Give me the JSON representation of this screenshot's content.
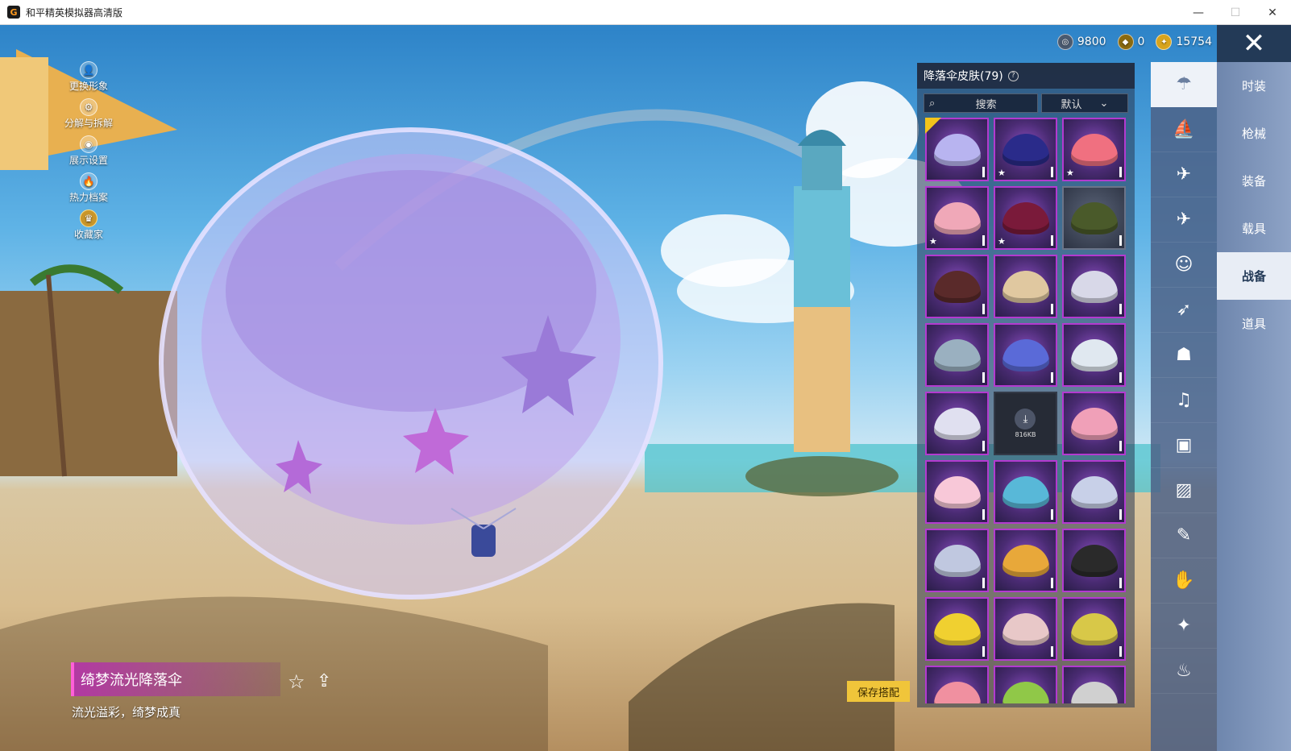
{
  "window": {
    "title": "和平精英模拟器高清版",
    "app_icon": "G",
    "minimize": "—",
    "maximize": "☐",
    "close": "✕"
  },
  "left_menu": [
    {
      "label": "更换形象",
      "icon": "user-icon",
      "glyph": "👤"
    },
    {
      "label": "分解与拆解",
      "icon": "gear-icon",
      "glyph": "⚙"
    },
    {
      "label": "展示设置",
      "icon": "eye-icon",
      "glyph": "◉"
    },
    {
      "label": "热力档案",
      "icon": "flame-icon",
      "glyph": "🔥"
    },
    {
      "label": "收藏家",
      "icon": "collector-icon",
      "glyph": "♛"
    }
  ],
  "currency": [
    {
      "value": "9800",
      "icon": "silver-coin-icon",
      "color": "#4a5a70"
    },
    {
      "value": "0",
      "icon": "gold-badge-icon",
      "color": "#8a6a10"
    },
    {
      "value": "15754",
      "icon": "coupon-icon",
      "color": "#d8a41c"
    }
  ],
  "close_glyph": "✕",
  "categories": [
    {
      "label": "时装",
      "active": false
    },
    {
      "label": "枪械",
      "active": false
    },
    {
      "label": "装备",
      "active": false
    },
    {
      "label": "载具",
      "active": false
    },
    {
      "label": "战备",
      "active": true
    },
    {
      "label": "道具",
      "active": false
    }
  ],
  "sub_icons": [
    {
      "name": "parachute-icon",
      "glyph": "☂",
      "active": true
    },
    {
      "name": "boat-icon",
      "glyph": "⛵",
      "active": false
    },
    {
      "name": "drone-icon",
      "glyph": "✈",
      "active": false
    },
    {
      "name": "plane-icon",
      "glyph": "✈",
      "active": false
    },
    {
      "name": "face-icon",
      "glyph": "☺",
      "active": false
    },
    {
      "name": "glider-icon",
      "glyph": "➶",
      "active": false
    },
    {
      "name": "robot-icon",
      "glyph": "☗",
      "active": false
    },
    {
      "name": "speaker-icon",
      "glyph": "♫",
      "active": false
    },
    {
      "name": "chat-icon",
      "glyph": "▣",
      "active": false
    },
    {
      "name": "picture-icon",
      "glyph": "▨",
      "active": false
    },
    {
      "name": "spray-icon",
      "glyph": "✎",
      "active": false
    },
    {
      "name": "gesture-icon",
      "glyph": "✋",
      "active": false
    },
    {
      "name": "magic-wand-icon",
      "glyph": "✦",
      "active": false
    },
    {
      "name": "chicken-icon",
      "glyph": "♨",
      "active": false
    }
  ],
  "panel": {
    "title": "降落伞皮肤(79)",
    "help_glyph": "?",
    "search_placeholder": "搜索",
    "sort_value": "默认",
    "download_size": "816KB"
  },
  "skins": [
    {
      "style": "purple",
      "star": false,
      "checked": true,
      "color": "#b8b4f0"
    },
    {
      "style": "purple",
      "star": true,
      "checked": false,
      "color": "#2a2b8a"
    },
    {
      "style": "purple",
      "star": true,
      "checked": false,
      "color": "#f07080"
    },
    {
      "style": "purple",
      "star": true,
      "checked": false,
      "color": "#f0a8b8"
    },
    {
      "style": "purple",
      "star": true,
      "checked": false,
      "color": "#7a1a3a"
    },
    {
      "style": "grey",
      "star": false,
      "checked": false,
      "color": "#4a5a2a"
    },
    {
      "style": "purple",
      "star": false,
      "checked": false,
      "color": "#5a2a2a"
    },
    {
      "style": "purple",
      "star": false,
      "checked": false,
      "color": "#e0c8a0"
    },
    {
      "style": "purple",
      "star": false,
      "checked": false,
      "color": "#d8d8e8"
    },
    {
      "style": "purple",
      "star": false,
      "checked": false,
      "color": "#9ab0c0"
    },
    {
      "style": "purple",
      "star": false,
      "checked": false,
      "color": "#5a6ad8"
    },
    {
      "style": "purple",
      "star": false,
      "checked": false,
      "color": "#e0e8f0"
    },
    {
      "style": "purple",
      "star": false,
      "checked": false,
      "color": "#e0e0f0"
    },
    {
      "style": "download",
      "star": false,
      "checked": false,
      "color": "#4d5568"
    },
    {
      "style": "purple",
      "star": false,
      "checked": false,
      "color": "#f0a0b8"
    },
    {
      "style": "purple",
      "star": false,
      "checked": false,
      "color": "#f8c8d8"
    },
    {
      "style": "purple",
      "star": false,
      "checked": false,
      "color": "#58b8d8"
    },
    {
      "style": "purple",
      "star": false,
      "checked": false,
      "color": "#c8d0e8"
    },
    {
      "style": "purple",
      "star": false,
      "checked": false,
      "color": "#c0c8e0"
    },
    {
      "style": "purple",
      "star": false,
      "checked": false,
      "color": "#e8a83a"
    },
    {
      "style": "purple",
      "star": false,
      "checked": false,
      "color": "#2a2a2a"
    },
    {
      "style": "purple",
      "star": false,
      "checked": false,
      "color": "#f0d030"
    },
    {
      "style": "purple",
      "star": false,
      "checked": false,
      "color": "#e8c8c8"
    },
    {
      "style": "purple",
      "star": false,
      "checked": false,
      "color": "#d8c848"
    },
    {
      "style": "purple",
      "star": false,
      "checked": false,
      "color": "#f090a0"
    },
    {
      "style": "purple",
      "star": false,
      "checked": false,
      "color": "#90c848"
    },
    {
      "style": "purple",
      "star": false,
      "checked": false,
      "color": "#d0d0d0"
    }
  ],
  "item": {
    "name": "绮梦流光降落伞",
    "description": "流光溢彩，绮梦成真",
    "fav_glyph": "☆",
    "share_glyph": "⇪"
  },
  "save_button": "保存搭配",
  "colors": {
    "active_border": "#b33ad0",
    "save_button": "#f0c53a",
    "nav_active_bg": "#e8edf5"
  }
}
